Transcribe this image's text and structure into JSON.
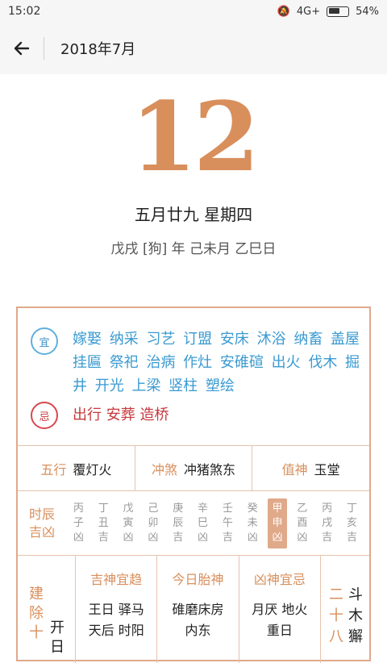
{
  "status": {
    "time": "15:02",
    "network": "4G+",
    "battery": "54%"
  },
  "header": {
    "title": "2018年7月"
  },
  "day": {
    "number": "12",
    "lunar_weekday": "五月廿九 星期四",
    "ganzhi": "戊戌 [狗] 年 己未月 乙巳日"
  },
  "yi": {
    "badge": "宜",
    "text": "嫁娶 纳采 习艺 订盟 安床 沐浴 纳畜 盖屋 挂匾 祭祀 治病 作灶 安碓碹 出火 伐木 掘井 开光 上梁 竖柱 塑绘"
  },
  "ji": {
    "badge": "忌",
    "text": "出行 安葬 造桥"
  },
  "info": {
    "wuxing_label": "五行",
    "wuxing_value": "覆灯火",
    "chongsha_label": "冲煞",
    "chongsha_value": "冲猪煞东",
    "zhishen_label": "值神",
    "zhishen_value": "玉堂"
  },
  "hours": {
    "label": "时辰吉凶",
    "items": [
      {
        "l1": "丙",
        "l2": "子",
        "l3": "凶"
      },
      {
        "l1": "丁",
        "l2": "丑",
        "l3": "吉"
      },
      {
        "l1": "戊",
        "l2": "寅",
        "l3": "凶"
      },
      {
        "l1": "己",
        "l2": "卯",
        "l3": "凶"
      },
      {
        "l1": "庚",
        "l2": "辰",
        "l3": "吉"
      },
      {
        "l1": "辛",
        "l2": "巳",
        "l3": "凶"
      },
      {
        "l1": "壬",
        "l2": "午",
        "l3": "吉"
      },
      {
        "l1": "癸",
        "l2": "未",
        "l3": "凶"
      },
      {
        "l1": "甲",
        "l2": "申",
        "l3": "凶"
      },
      {
        "l1": "乙",
        "l2": "酉",
        "l3": "凶"
      },
      {
        "l1": "丙",
        "l2": "戌",
        "l3": "吉"
      },
      {
        "l1": "丁",
        "l2": "亥",
        "l3": "吉"
      }
    ]
  },
  "bottom": {
    "jianchu": "建除十",
    "jianchu_value": "开日",
    "jishen_label": "吉神宜趋",
    "jishen_value": "王日 驿马 天后 时阳",
    "taishen_label": "今日胎神",
    "taishen_value": "碓磨床房 内东",
    "xiongshen_label": "凶神宜忌",
    "xiongshen_value": "月厌 地火 重日",
    "star_label": "二十八",
    "star_value": "斗木獬"
  },
  "colors": {
    "accent": "#d88f5c",
    "yi_blue": "#3a9ad1",
    "ji_red": "#c5383c"
  }
}
